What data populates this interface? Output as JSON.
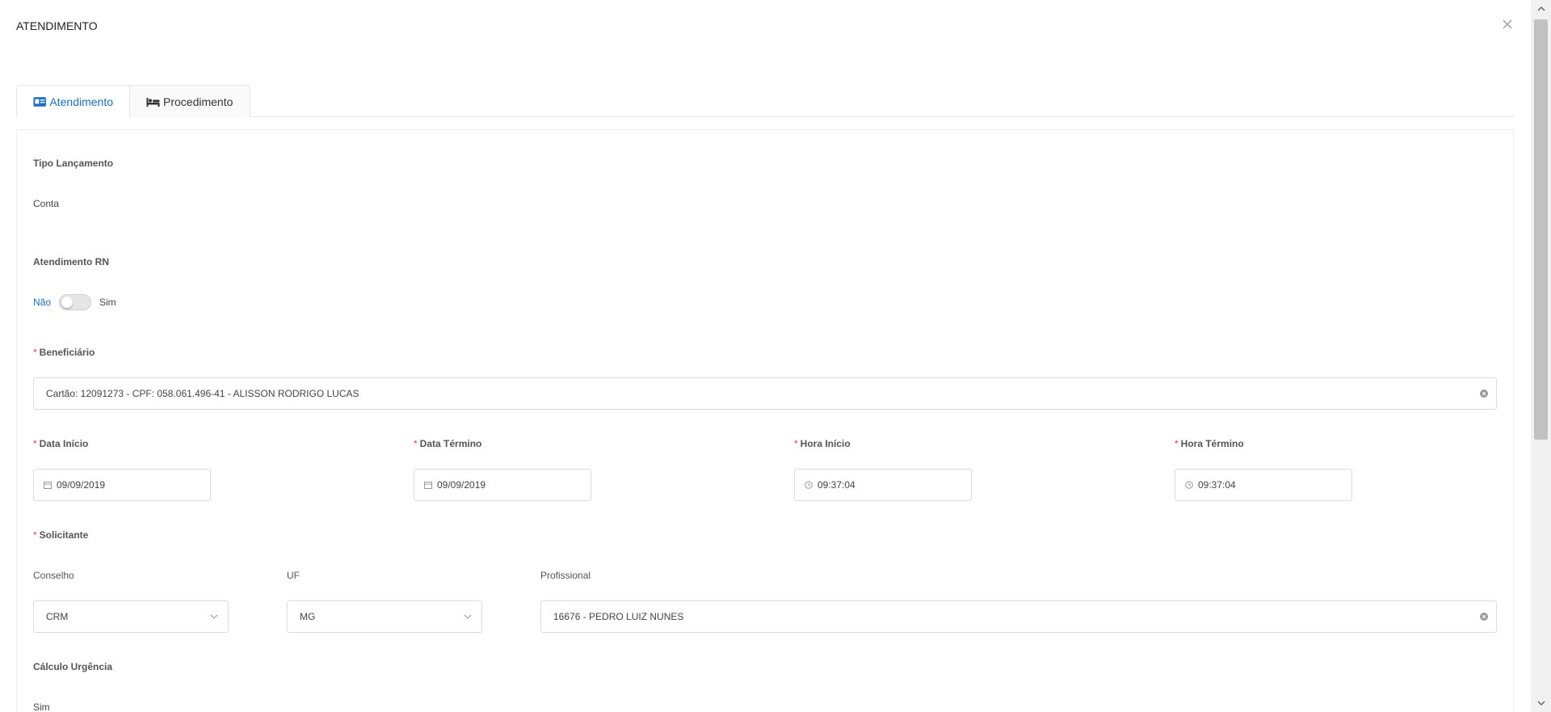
{
  "modal": {
    "title": "ATENDIMENTO"
  },
  "tabs": [
    {
      "label": "Atendimento",
      "icon": "id-card-icon",
      "active": true
    },
    {
      "label": "Procedimento",
      "icon": "bed-icon",
      "active": false
    }
  ],
  "form": {
    "tipo_lancamento": {
      "label": "Tipo Lançamento",
      "value": "Conta"
    },
    "atendimento_rn": {
      "label": "Atendimento RN",
      "off_label": "Não",
      "on_label": "Sim",
      "checked": false
    },
    "beneficiario": {
      "label": "Beneficiário",
      "value": "Cartão: 12091273 - CPF: 058.061.496-41 - ALISSON RODRIGO LUCAS"
    },
    "data_inicio": {
      "label": "Data Início",
      "value": "09/09/2019"
    },
    "data_termino": {
      "label": "Data Término",
      "value": "09/09/2019"
    },
    "hora_inicio": {
      "label": "Hora Início",
      "value": "09:37:04"
    },
    "hora_termino": {
      "label": "Hora Término",
      "value": "09:37:04"
    },
    "solicitante": {
      "label": "Solicitante",
      "conselho": {
        "label": "Conselho",
        "value": "CRM"
      },
      "uf": {
        "label": "UF",
        "value": "MG"
      },
      "profissional": {
        "label": "Profissional",
        "value": "16676 - PEDRO LUIZ NUNES"
      }
    },
    "calculo_urgencia": {
      "label": "Cálculo Urgência",
      "value": "Sim"
    }
  },
  "colors": {
    "accent": "#1a6fc4",
    "required": "#e4453a",
    "border": "#dcdcdc"
  }
}
